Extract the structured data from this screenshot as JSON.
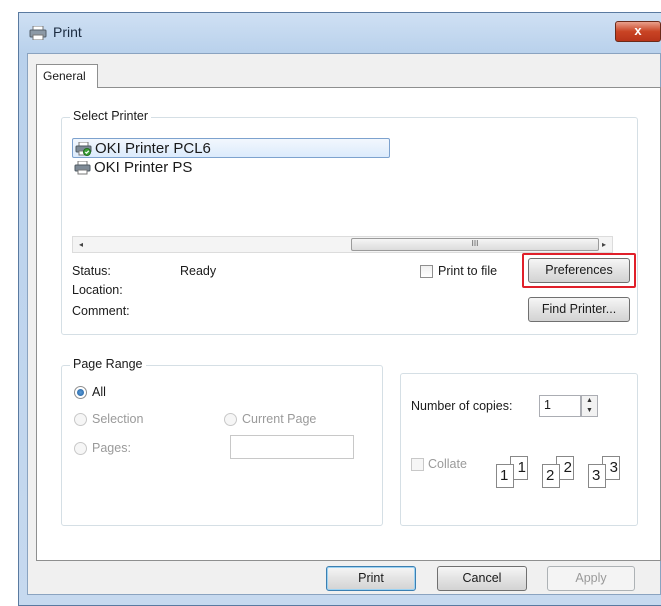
{
  "window": {
    "title": "Print",
    "close_label": "x"
  },
  "tabs": [
    {
      "label": "General"
    }
  ],
  "select_printer": {
    "legend": "Select Printer",
    "printers": [
      {
        "name": "OKI Printer PCL6",
        "selected": true
      },
      {
        "name": "OKI Printer PS",
        "selected": false
      }
    ],
    "scroll_left": "◂",
    "scroll_right": "▸",
    "thumb_grip": "III",
    "status_label": "Status:",
    "status_value": "Ready",
    "location_label": "Location:",
    "location_value": "",
    "comment_label": "Comment:",
    "comment_value": "",
    "print_to_file_label": "Print to file",
    "print_to_file_checked": false,
    "preferences_label": "Preferences",
    "find_printer_label": "Find Printer..."
  },
  "page_range": {
    "legend": "Page Range",
    "all_label": "All",
    "selection_label": "Selection",
    "current_page_label": "Current Page",
    "pages_label": "Pages:",
    "pages_value": "",
    "selected_option": "All"
  },
  "copies": {
    "number_label": "Number of copies:",
    "number_value": "1",
    "collate_label": "Collate",
    "collate_checked": false,
    "collate_pages": [
      "1",
      "1",
      "2",
      "2",
      "3",
      "3"
    ]
  },
  "footer": {
    "print_label": "Print",
    "cancel_label": "Cancel",
    "apply_label": "Apply"
  },
  "colors": {
    "highlight": "#e0202a",
    "close_button": "#c94424",
    "title_gradient": "#b9d1ec"
  }
}
